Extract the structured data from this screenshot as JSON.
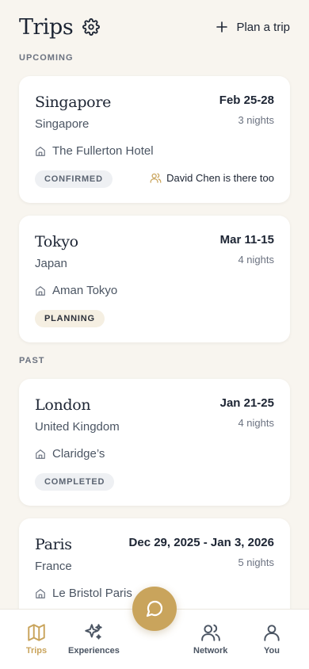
{
  "header": {
    "title": "Trips",
    "plan_label": "Plan a trip"
  },
  "sections": {
    "upcoming": "UPCOMING",
    "past": "PAST"
  },
  "trips": [
    {
      "city": "Singapore",
      "country": "Singapore",
      "dates": "Feb 25-28",
      "nights": "3 nights",
      "hotel": "The Fullerton Hotel",
      "status": "CONFIRMED",
      "companion": "David Chen is there too"
    },
    {
      "city": "Tokyo",
      "country": "Japan",
      "dates": "Mar 11-15",
      "nights": "4 nights",
      "hotel": "Aman Tokyo",
      "status": "PLANNING"
    },
    {
      "city": "London",
      "country": "United Kingdom",
      "dates": "Jan 21-25",
      "nights": "4 nights",
      "hotel": "Claridge’s",
      "status": "COMPLETED"
    },
    {
      "city": "Paris",
      "country": "France",
      "dates": "Dec 29, 2025 - Jan 3, 2026",
      "nights": "5 nights",
      "hotel": "Le Bristol Paris"
    }
  ],
  "nav": {
    "trips": "Trips",
    "experiences": "Experiences",
    "network": "Network",
    "you": "You"
  },
  "colors": {
    "accent": "#c9a45c",
    "background": "#f8f5ef",
    "text": "#1c2433"
  },
  "icons": [
    "gear-icon",
    "plus-icon",
    "hotel-icon",
    "people-icon",
    "map-icon",
    "sparkles-icon",
    "chat-icon",
    "user-icon"
  ]
}
